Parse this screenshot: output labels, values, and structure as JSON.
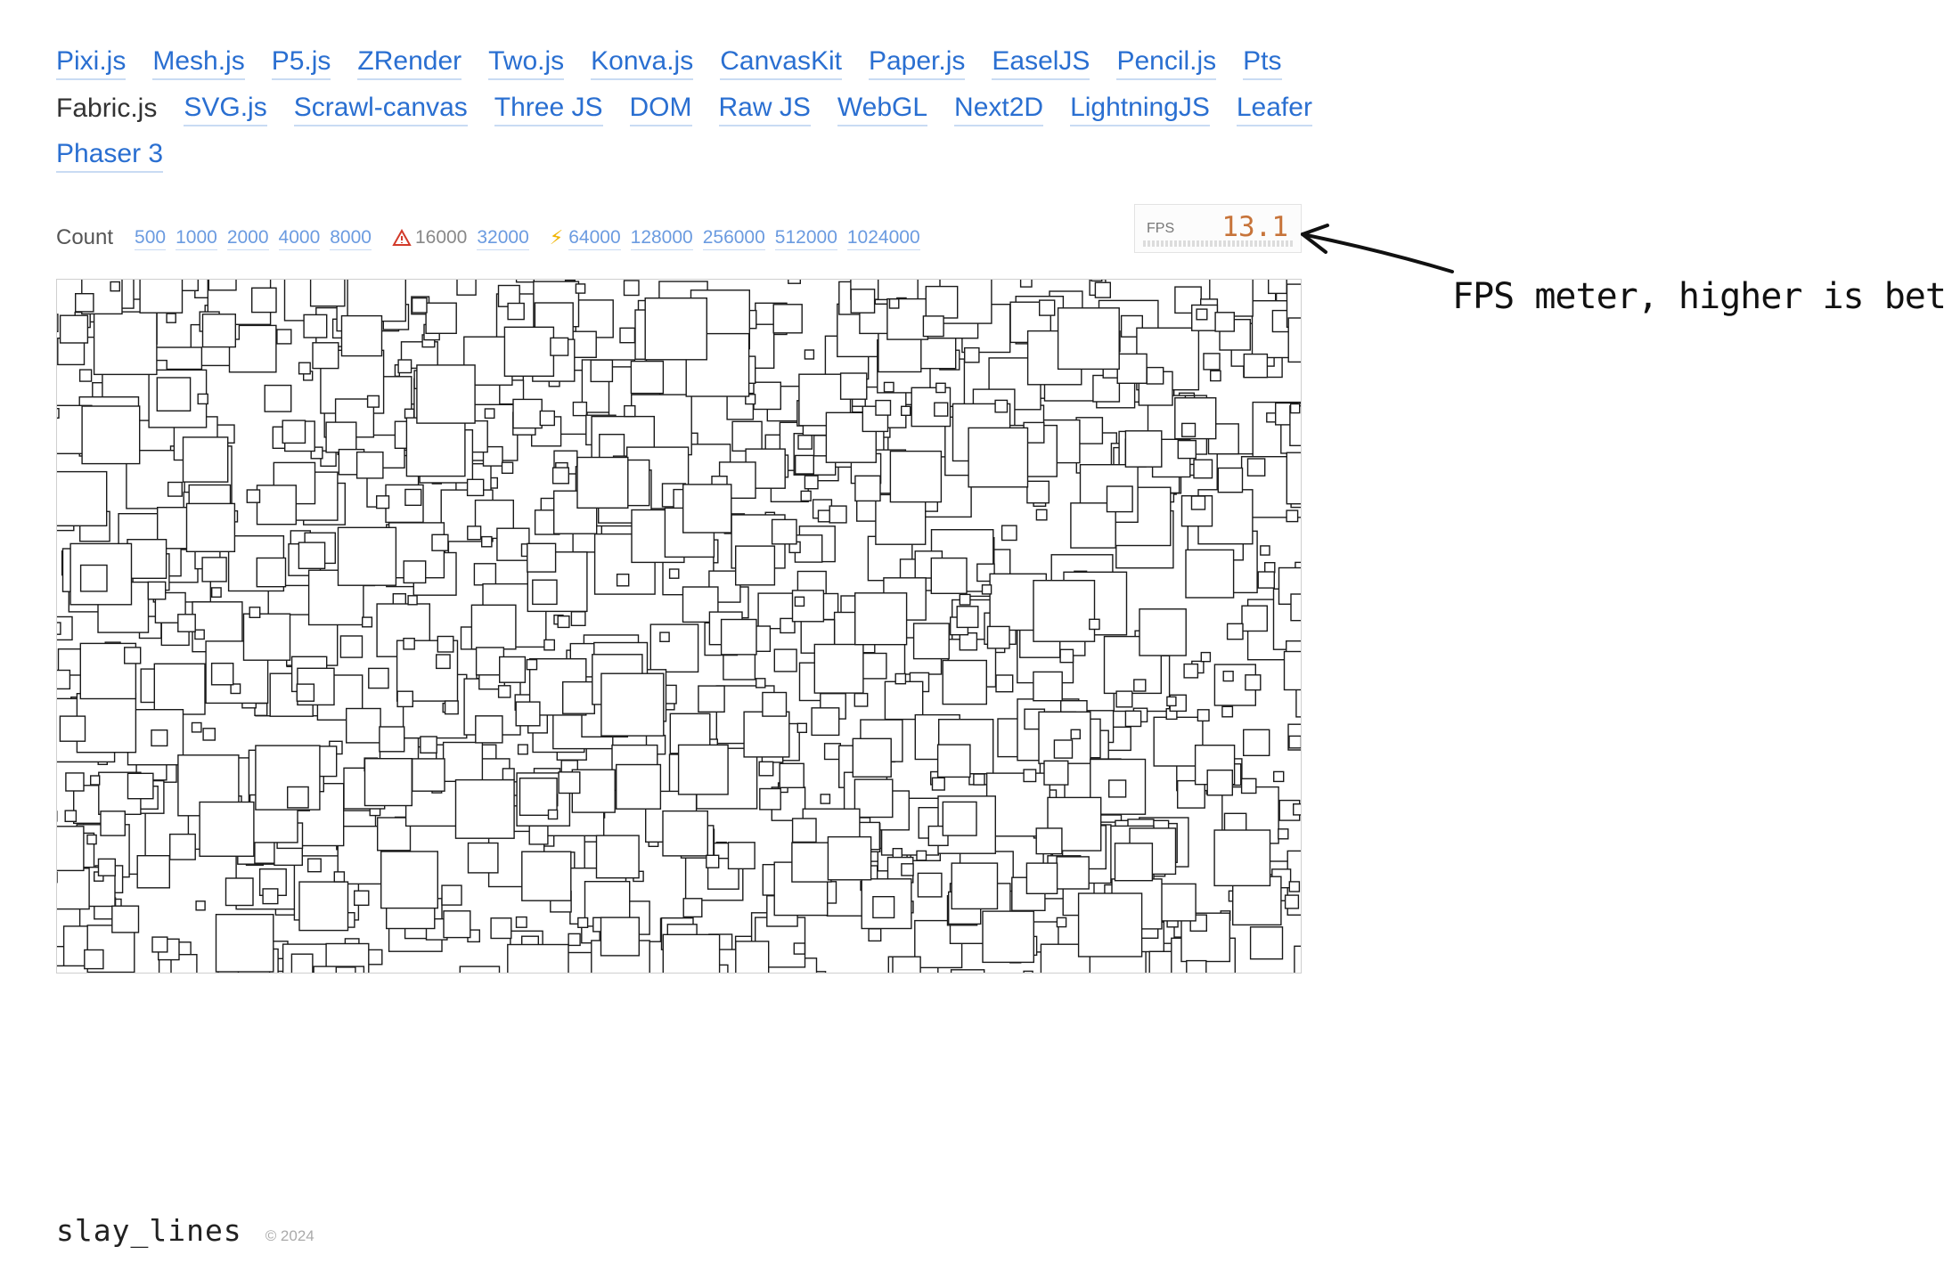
{
  "nav": {
    "rows": [
      [
        {
          "label": "Pixi.js",
          "current": false
        },
        {
          "label": "Mesh.js",
          "current": false
        },
        {
          "label": "P5.js",
          "current": false
        },
        {
          "label": "ZRender",
          "current": false
        },
        {
          "label": "Two.js",
          "current": false
        },
        {
          "label": "Konva.js",
          "current": false
        },
        {
          "label": "CanvasKit",
          "current": false
        },
        {
          "label": "Paper.js",
          "current": false
        },
        {
          "label": "EaselJS",
          "current": false
        },
        {
          "label": "Pencil.js",
          "current": false
        },
        {
          "label": "Pts",
          "current": false
        }
      ],
      [
        {
          "label": "Fabric.js",
          "current": true
        },
        {
          "label": "SVG.js",
          "current": false
        },
        {
          "label": "Scrawl-canvas",
          "current": false
        },
        {
          "label": "Three JS",
          "current": false
        },
        {
          "label": "DOM",
          "current": false
        },
        {
          "label": "Raw JS",
          "current": false
        },
        {
          "label": "WebGL",
          "current": false
        },
        {
          "label": "Next2D",
          "current": false
        },
        {
          "label": "LightningJS",
          "current": false
        },
        {
          "label": "Leafer",
          "current": false
        }
      ],
      [
        {
          "label": "Phaser 3",
          "current": false
        }
      ]
    ]
  },
  "count": {
    "label": "Count",
    "options": [
      {
        "value": "500",
        "link": true,
        "icon": ""
      },
      {
        "value": "1000",
        "link": true,
        "icon": ""
      },
      {
        "value": "2000",
        "link": true,
        "icon": ""
      },
      {
        "value": "4000",
        "link": true,
        "icon": ""
      },
      {
        "value": "8000",
        "link": true,
        "icon": ""
      },
      {
        "value": "16000",
        "link": false,
        "icon": "warning-icon"
      },
      {
        "value": "32000",
        "link": true,
        "icon": ""
      },
      {
        "value": "64000",
        "link": true,
        "icon": "lightning-icon"
      },
      {
        "value": "128000",
        "link": true,
        "icon": ""
      },
      {
        "value": "256000",
        "link": true,
        "icon": ""
      },
      {
        "value": "512000",
        "link": true,
        "icon": ""
      },
      {
        "value": "1024000",
        "link": true,
        "icon": ""
      }
    ]
  },
  "fps": {
    "label": "FPS",
    "value": "13.1",
    "value_color": "#c7743a"
  },
  "annotation": {
    "text": "FPS meter, higher is better"
  },
  "footer": {
    "brand": "slay_lines",
    "copyright": "© 2024"
  },
  "colors": {
    "link": "#2a6fd1",
    "square_stroke": "#1a1a1a",
    "warning": "#d23a2a",
    "lightning": "#f0b400"
  }
}
